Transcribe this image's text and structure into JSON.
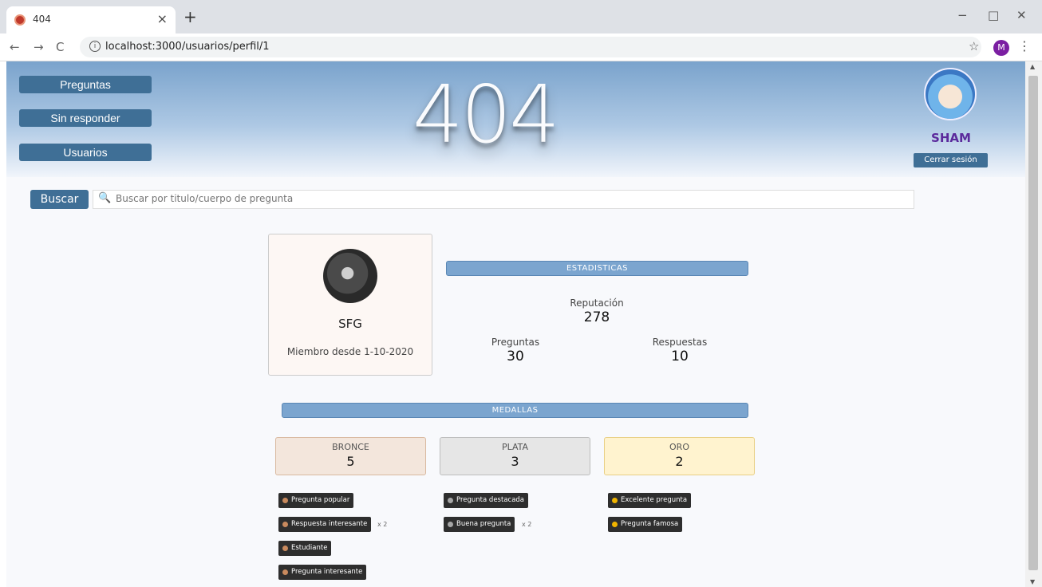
{
  "browser": {
    "tab_title": "404",
    "url": "localhost:3000/usuarios/perfil/1",
    "profile_initial": "M",
    "window_buttons": [
      "−",
      "□",
      "✕"
    ]
  },
  "nav": {
    "items": [
      {
        "label": "Preguntas"
      },
      {
        "label": "Sin responder"
      },
      {
        "label": "Usuarios"
      }
    ]
  },
  "header": {
    "title": "404",
    "username": "SHAM",
    "logout_label": "Cerrar sesión"
  },
  "search": {
    "button_label": "Buscar",
    "placeholder": "Buscar por titulo/cuerpo de pregunta"
  },
  "profile": {
    "name": "SFG",
    "member_since": "Miembro desde 1-10-2020"
  },
  "stats": {
    "heading": "Estadisticas",
    "reputation_label": "Reputación",
    "reputation_value": "278",
    "questions_label": "Preguntas",
    "questions_value": "30",
    "answers_label": "Respuestas",
    "answers_value": "10"
  },
  "medals": {
    "heading": "Medallas",
    "bronze": {
      "label": "BRONCE",
      "count": "5",
      "color": "#f3e6dc"
    },
    "silver": {
      "label": "PLATA",
      "count": "3",
      "color": "#e6e6e6"
    },
    "gold": {
      "label": "ORO",
      "count": "2",
      "color": "#fff3cf"
    },
    "bronze_badges": [
      {
        "label": "Pregunta popular",
        "multiplier": ""
      },
      {
        "label": "Respuesta interesante",
        "multiplier": "x 2"
      },
      {
        "label": "Estudiante",
        "multiplier": ""
      },
      {
        "label": "Pregunta interesante",
        "multiplier": ""
      }
    ],
    "silver_badges": [
      {
        "label": "Pregunta destacada",
        "multiplier": ""
      },
      {
        "label": "Buena pregunta",
        "multiplier": "x 2"
      }
    ],
    "gold_badges": [
      {
        "label": "Excelente pregunta",
        "multiplier": ""
      },
      {
        "label": "Pregunta famosa",
        "multiplier": ""
      }
    ],
    "dot_colors": {
      "bronze": "#c98a5e",
      "silver": "#a7a7a7",
      "gold": "#f0b400"
    }
  }
}
